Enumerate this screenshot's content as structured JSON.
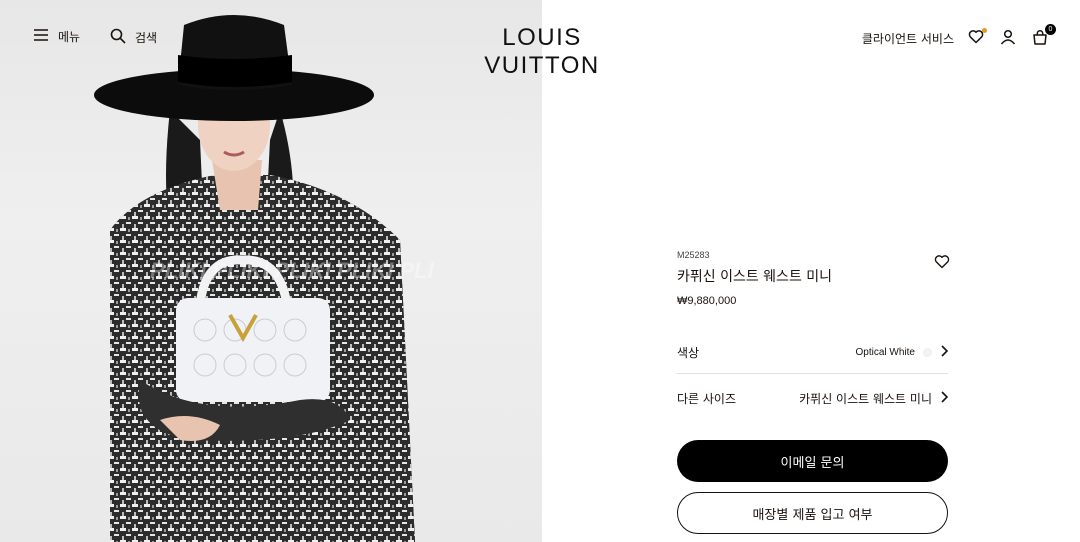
{
  "header": {
    "menu_label": "메뉴",
    "search_label": "검색",
    "logo": "LOUIS VUITTON",
    "client_service": "클라이언트 서비스",
    "bag_count": "0"
  },
  "photo": {
    "watermark": "PLIKI   PLIKI   PLIKI   PLIKI   PLI"
  },
  "product": {
    "sku": "M25283",
    "name": "카퓌신 이스트 웨스트 미니",
    "price": "₩9,880,000"
  },
  "options": {
    "color_label": "색상",
    "color_value": "Optical White",
    "size_label": "다른 사이즈",
    "size_value": "카퓌신 이스트 웨스트 미니"
  },
  "actions": {
    "email_label": "이메일 문의",
    "store_label": "매장별 제품 입고 여부"
  },
  "colors": {
    "text": "#19110b",
    "wishlist_dot": "#e3972a",
    "primary_button": "#000000"
  }
}
